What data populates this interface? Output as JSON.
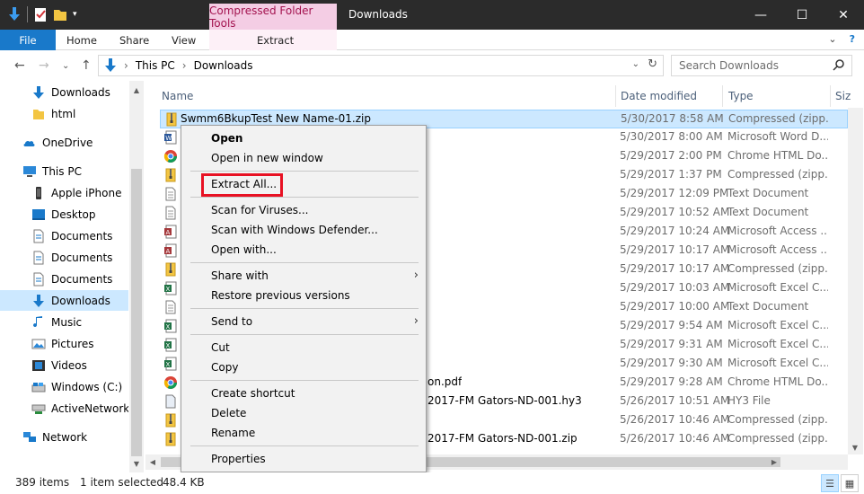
{
  "window": {
    "title": "Downloads",
    "contextual_tab_group": "Compressed Folder Tools",
    "controls": {
      "minimize": "—",
      "maximize": "☐",
      "close": "✕"
    }
  },
  "ribbon": {
    "tabs": [
      "File",
      "Home",
      "Share",
      "View",
      "Extract"
    ],
    "right": {
      "collapse": "⌄",
      "help": "?"
    }
  },
  "address": {
    "back": "←",
    "forward": "→",
    "recent": "⌄",
    "up": "↑",
    "segments": [
      "This PC",
      "Downloads"
    ],
    "separator": "›",
    "dropdown": "⌄",
    "refresh": "↻"
  },
  "search": {
    "placeholder": "Search Downloads",
    "icon": "search-icon"
  },
  "nav": {
    "items": [
      {
        "label": "Downloads",
        "icon": "downloads-icon"
      },
      {
        "label": "html",
        "icon": "folder-icon"
      },
      {
        "label": "OneDrive",
        "icon": "onedrive-icon"
      },
      {
        "label": "This PC",
        "icon": "pc-icon"
      },
      {
        "label": "Apple iPhone",
        "icon": "phone-icon"
      },
      {
        "label": "Desktop",
        "icon": "desktop-icon"
      },
      {
        "label": "Documents",
        "icon": "documents-icon"
      },
      {
        "label": "Documents",
        "icon": "documents-icon"
      },
      {
        "label": "Documents",
        "icon": "documents-icon"
      },
      {
        "label": "Downloads",
        "icon": "downloads-icon"
      },
      {
        "label": "Music",
        "icon": "music-icon"
      },
      {
        "label": "Pictures",
        "icon": "pictures-icon"
      },
      {
        "label": "Videos",
        "icon": "videos-icon"
      },
      {
        "label": "Windows (C:)",
        "icon": "drive-icon"
      },
      {
        "label": "ActiveNetwork D",
        "icon": "network-drive-icon"
      },
      {
        "label": "Network",
        "icon": "network-icon"
      }
    ]
  },
  "columns": {
    "name": "Name",
    "date": "Date modified",
    "type": "Type",
    "size": "Siz"
  },
  "files": [
    {
      "name": "Swmm6BkupTest New Name-01.zip",
      "date": "5/30/2017 8:58 AM",
      "type": "Compressed (zipp...",
      "icon": "zip-icon"
    },
    {
      "name": "",
      "date": "5/30/2017 8:00 AM",
      "type": "Microsoft Word D...",
      "icon": "word-icon"
    },
    {
      "name": "",
      "date": "5/29/2017 2:00 PM",
      "type": "Chrome HTML Do...",
      "icon": "chrome-icon"
    },
    {
      "name": "",
      "date": "5/29/2017 1:37 PM",
      "type": "Compressed (zipp...",
      "icon": "zip-icon"
    },
    {
      "name": "",
      "date": "5/29/2017 12:09 PM",
      "type": "Text Document",
      "icon": "text-icon"
    },
    {
      "name": "",
      "date": "5/29/2017 10:52 AM",
      "type": "Text Document",
      "icon": "text-icon"
    },
    {
      "name": "",
      "date": "5/29/2017 10:24 AM",
      "type": "Microsoft Access ...",
      "icon": "access-icon"
    },
    {
      "name": "",
      "date": "5/29/2017 10:17 AM",
      "type": "Microsoft Access ...",
      "icon": "access-icon"
    },
    {
      "name": "",
      "date": "5/29/2017 10:17 AM",
      "type": "Compressed (zipp...",
      "icon": "zip-icon"
    },
    {
      "name": "",
      "date": "5/29/2017 10:03 AM",
      "type": "Microsoft Excel C...",
      "icon": "excel-icon"
    },
    {
      "name": "",
      "date": "5/29/2017 10:00 AM",
      "type": "Text Document",
      "icon": "text-icon"
    },
    {
      "name": "",
      "date": "5/29/2017 9:54 AM",
      "type": "Microsoft Excel C...",
      "icon": "excel-icon"
    },
    {
      "name": "",
      "date": "5/29/2017 9:31 AM",
      "type": "Microsoft Excel C...",
      "icon": "excel-icon"
    },
    {
      "name": "",
      "date": "5/29/2017 9:30 AM",
      "type": "Microsoft Excel C...",
      "icon": "excel-icon"
    },
    {
      "name": "on.pdf",
      "date": "5/29/2017 9:28 AM",
      "type": "Chrome HTML Do...",
      "icon": "chrome-icon"
    },
    {
      "name": "2017-FM Gators-ND-001.hy3",
      "date": "5/26/2017 10:51 AM",
      "type": "HY3 File",
      "icon": "file-icon"
    },
    {
      "name": "",
      "date": "5/26/2017 10:46 AM",
      "type": "Compressed (zipp...",
      "icon": "zip-icon"
    },
    {
      "name": "2017-FM Gators-ND-001.zip",
      "date": "5/26/2017 10:46 AM",
      "type": "Compressed (zipp...",
      "icon": "zip-icon"
    }
  ],
  "context_menu": {
    "items": [
      {
        "label": "Open",
        "bold": true
      },
      {
        "label": "Open in new window"
      },
      {
        "sep": true
      },
      {
        "label": "Extract All..."
      },
      {
        "sep": true
      },
      {
        "label": "Scan for Viruses..."
      },
      {
        "label": "Scan with Windows Defender..."
      },
      {
        "label": "Open with..."
      },
      {
        "sep": true
      },
      {
        "label": "Share with",
        "submenu": true
      },
      {
        "label": "Restore previous versions"
      },
      {
        "sep": true
      },
      {
        "label": "Send to",
        "submenu": true
      },
      {
        "sep": true
      },
      {
        "label": "Cut"
      },
      {
        "label": "Copy"
      },
      {
        "sep": true
      },
      {
        "label": "Create shortcut"
      },
      {
        "label": "Delete"
      },
      {
        "label": "Rename"
      },
      {
        "sep": true
      },
      {
        "label": "Properties"
      }
    ],
    "highlighted": "Extract All...",
    "submenu_arrow": "›"
  },
  "status": {
    "items_count": "389 items",
    "selection": "1 item selected",
    "size": "48.4 KB"
  },
  "view_buttons": {
    "details": "☰",
    "large_icons": "▦"
  },
  "colors": {
    "accent": "#1979ca",
    "contextual": "#f4cde4",
    "selection": "#cce8ff",
    "highlight": "#e81123"
  }
}
